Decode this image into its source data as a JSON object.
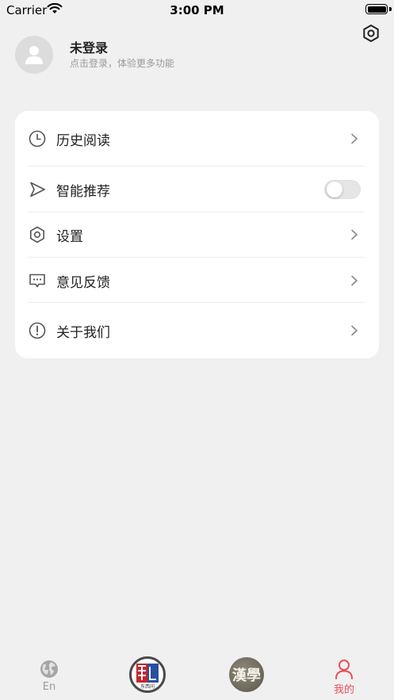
{
  "status_bar": {
    "carrier": "Carrier",
    "time": "3:00 PM"
  },
  "profile": {
    "title": "未登录",
    "subtitle": "点击登录，体验更多功能"
  },
  "menu": [
    {
      "label": "历史阅读",
      "icon": "clock-icon",
      "control": "chevron"
    },
    {
      "label": "智能推荐",
      "icon": "send-icon",
      "control": "toggle",
      "toggle_on": false
    },
    {
      "label": "设置",
      "icon": "hexagon-gear-icon",
      "control": "chevron"
    },
    {
      "label": "意见反馈",
      "icon": "chat-bubble-icon",
      "control": "chevron"
    },
    {
      "label": "关于我们",
      "icon": "info-circle-icon",
      "control": "chevron"
    }
  ],
  "tabbar": {
    "tab_en": {
      "label": "En",
      "icon": "globe-icon"
    },
    "tab_logo1": {
      "icon": "dongxiwen-logo-icon",
      "caption": "东西问"
    },
    "tab_logo2": {
      "icon": "hanxue-logo-icon",
      "text": "漢學"
    },
    "tab_mine": {
      "label": "我的",
      "icon": "person-icon"
    }
  },
  "colors": {
    "accent_red": "#e8505b",
    "background": "#f0f0f0",
    "card": "#ffffff",
    "muted": "#9a9a9a"
  }
}
